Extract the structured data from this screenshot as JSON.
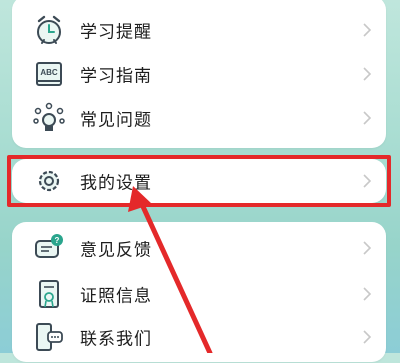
{
  "menu_group_1": {
    "items": [
      {
        "label": "学习提醒",
        "icon": "alarm-clock-icon"
      },
      {
        "label": "学习指南",
        "icon": "abc-book-icon"
      },
      {
        "label": "常见问题",
        "icon": "question-bulb-icon"
      }
    ]
  },
  "menu_group_2": {
    "items": [
      {
        "label": "我的设置",
        "icon": "settings-gear-icon"
      }
    ]
  },
  "menu_group_3": {
    "items": [
      {
        "label": "意见反馈",
        "icon": "feedback-chat-icon"
      },
      {
        "label": "证照信息",
        "icon": "certificate-scroll-icon"
      },
      {
        "label": "联系我们",
        "icon": "contact-phone-icon"
      }
    ]
  },
  "annotation": {
    "color": "#e4292a"
  }
}
